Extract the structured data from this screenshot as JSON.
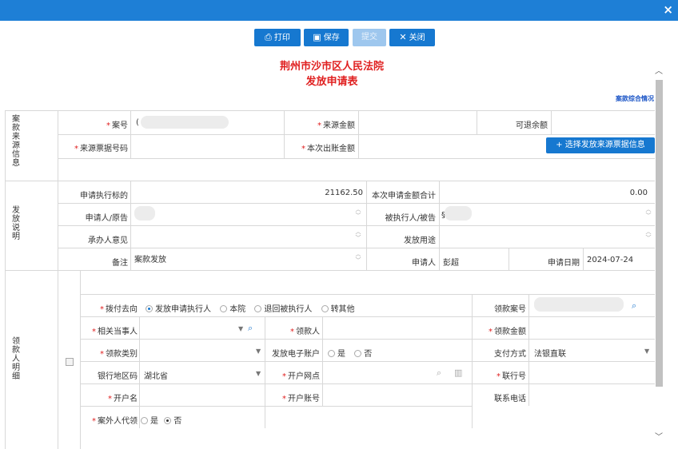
{
  "window": {
    "close_label": "×"
  },
  "toolbar": {
    "print_label": "打印",
    "save_label": "保存",
    "submit_label": "提交",
    "close_label": "关闭"
  },
  "header": {
    "court_name": "荆州市沙市区人民法院",
    "form_title": "发放申请表",
    "summary_link": "案款综合情况"
  },
  "case_source": {
    "section_label": "案款来源信息",
    "case_no_label": "案号",
    "case_no_value": "(",
    "source_amount_label": "来源金额",
    "refundable_label": "可退余额",
    "receipt_no_label": "来源票据号码",
    "payout_amount_label": "本次出账金额",
    "select_button_label": "+ 选择发放来源票据信息"
  },
  "payout": {
    "section_label": "发放说明",
    "exec_target_label": "申请执行标的",
    "exec_target_value": "21162.50",
    "total_label": "本次申请金额合计",
    "total_value": "0.00",
    "applicant_label": "申请人/原告",
    "respondent_label": "被执行人/被告",
    "respondent_value": "§",
    "officer_label": "承办人意见",
    "purpose_label": "发放用途",
    "remark_label": "备注",
    "remark_value": "案款发放",
    "apply_person_label": "申请人",
    "apply_person_value": "彭超",
    "apply_date_label": "申请日期",
    "apply_date_value": "2024-07-24"
  },
  "recipient": {
    "section_label": "领款人明细",
    "direction_label": "拨付去向",
    "direction_options": [
      "发放申请执行人",
      "本院",
      "退回被执行人",
      "转其他"
    ],
    "case_no_label": "领款案号",
    "party_label": "相关当事人",
    "payee_label": "领款人",
    "amount_label": "领款金额",
    "type_label": "领款类别",
    "e_account_label": "发放电子账户",
    "yes_label": "是",
    "no_label": "否",
    "pay_method_label": "支付方式",
    "pay_method_value": "法银直联",
    "bank_region_label": "银行地区码",
    "bank_region_value": "湖北省",
    "branch_label": "开户网点",
    "bank_code_label": "联行号",
    "account_name_label": "开户名",
    "account_no_label": "开户账号",
    "phone_label": "联系电话",
    "proxy_label": "案外人代领"
  }
}
